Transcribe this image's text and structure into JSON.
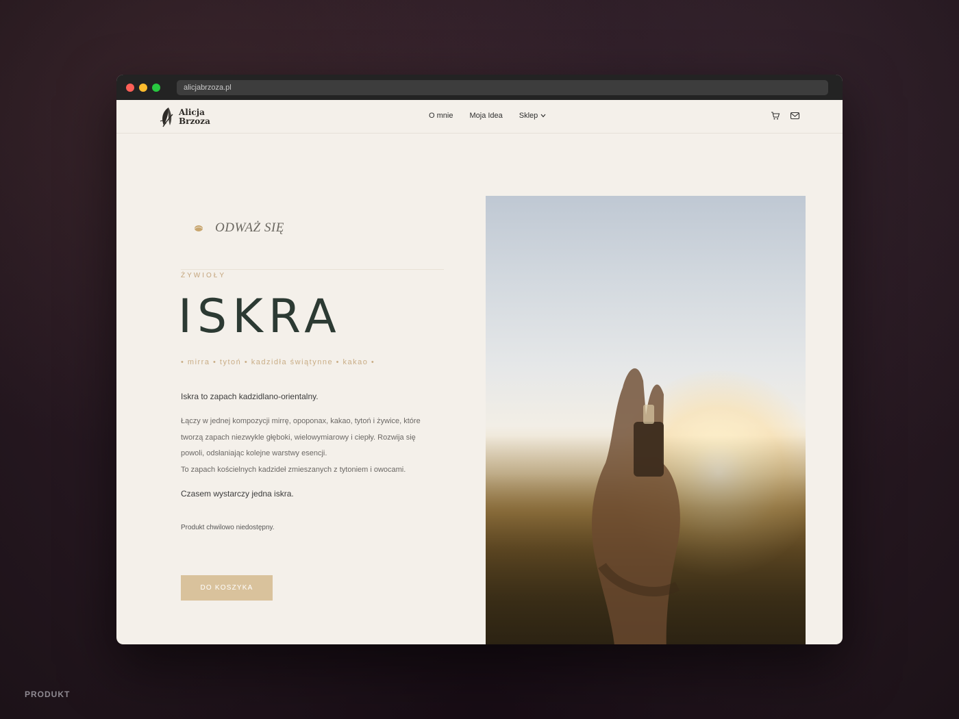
{
  "browser": {
    "url": "alicjabrzoza.pl"
  },
  "brand": {
    "line1": "Alicja",
    "line2": "Brzoza"
  },
  "nav": {
    "items": [
      {
        "label": "O mnie"
      },
      {
        "label": "Moja Idea"
      },
      {
        "label": "Sklep"
      }
    ]
  },
  "icons": {
    "cart": "cart-icon",
    "mail": "mail-icon",
    "dropdown": "chevron-down-icon",
    "tagline": "gold-leaf-icon"
  },
  "product": {
    "tagline": "ODWAŻ SIĘ",
    "category": "ŻYWIOŁY",
    "title": "ISKRA",
    "notes": "• mirra • tytoń • kadzidła świątynne • kakao •",
    "lead": "Iskra to zapach kadzidlano-orientalny.",
    "description_line1": "Łączy  w jednej kompozycji  mirrę, opoponax, kakao, tytoń i żywice, które tworzą zapach niezwykle głęboki, wielowymiarowy i ciepły. Rozwija się powoli, odsłaniając kolejne warstwy esencji.",
    "description_line2": "To zapach kościelnych kadzideł zmieszanych z tytoniem i owocami.",
    "closing": "Czasem wystarczy jedna iskra.",
    "availability": "Produkt chwilowo niedostępny.",
    "cart_button": "DO KOSZYKA"
  },
  "colors": {
    "accent": "#d9c29c",
    "title": "#2c3a33",
    "background": "#f4f0ea"
  },
  "footer": {
    "label": "PRODUKT"
  }
}
